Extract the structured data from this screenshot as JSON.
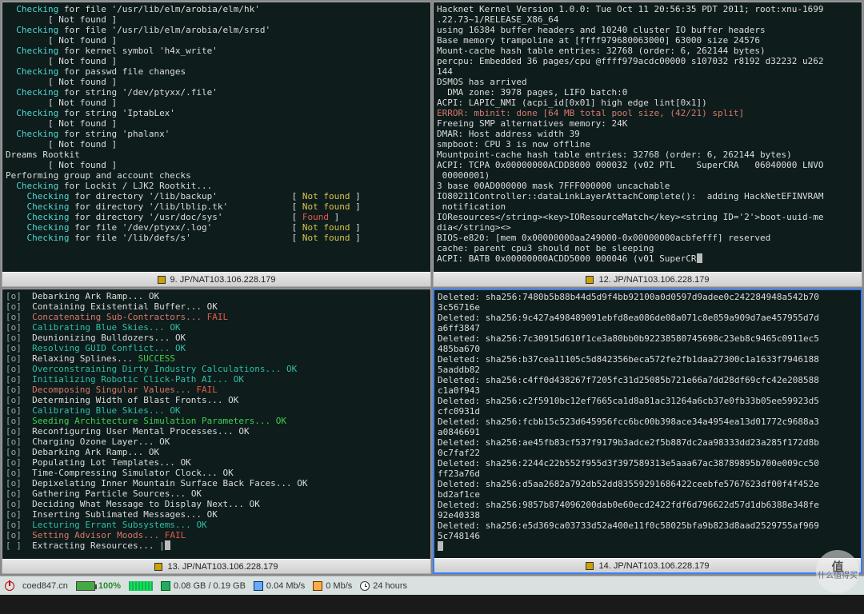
{
  "titles": {
    "p1": "9. JP/NAT103.106.228.179",
    "p2": "12. JP/NAT103.106.228.179",
    "p3": "13. JP/NAT103.106.228.179",
    "p4": "14. JP/NAT103.106.228.179"
  },
  "icon_label": "terminal-icon",
  "pane1": {
    "lines": [
      {
        "indent": 1,
        "pre": "Checking",
        "body": " for file '/usr/lib/elm/arobia/elm/hk'",
        "cls": "c-cyan"
      },
      {
        "indent": 4,
        "body": "[ Not found ]",
        "cls": "c-white"
      },
      {
        "indent": 1,
        "pre": "Checking",
        "body": " for file '/usr/lib/elm/arobia/elm/srsd'",
        "cls": "c-cyan"
      },
      {
        "indent": 4,
        "body": "[ Not found ]",
        "cls": "c-white"
      },
      {
        "indent": 1,
        "pre": "Checking",
        "body": " for kernel symbol 'h4x_write'",
        "cls": "c-cyan"
      },
      {
        "indent": 4,
        "body": "[ Not found ]",
        "cls": "c-white"
      },
      {
        "indent": 1,
        "pre": "Checking",
        "body": " for passwd file changes",
        "cls": "c-cyan"
      },
      {
        "indent": 4,
        "body": "[ Not found ]",
        "cls": "c-white"
      },
      {
        "indent": 1,
        "pre": "Checking",
        "body": " for string '/dev/ptyxx/.file'",
        "cls": "c-cyan"
      },
      {
        "indent": 4,
        "body": "[ Not found ]",
        "cls": "c-white"
      },
      {
        "indent": 1,
        "pre": "Checking",
        "body": " for string 'IptabLex'",
        "cls": "c-cyan"
      },
      {
        "indent": 4,
        "body": "[ Not found ]",
        "cls": "c-white"
      },
      {
        "indent": 1,
        "pre": "Checking",
        "body": " for string 'phalanx'",
        "cls": "c-cyan"
      },
      {
        "indent": 4,
        "body": "[ Not found ]",
        "cls": "c-white"
      },
      {
        "indent": 0,
        "body": "Dreams Rootkit",
        "cls": "c-white"
      },
      {
        "indent": 4,
        "body": "[ Not found ]",
        "cls": "c-white"
      },
      {
        "indent": 0,
        "body": "",
        "cls": ""
      },
      {
        "indent": 0,
        "body": "Performing group and account checks",
        "cls": "c-white"
      },
      {
        "indent": 1,
        "pre": "Checking",
        "body": " for Lockit / LJK2 Rootkit...",
        "cls": "c-cyan"
      }
    ],
    "dir_rows": [
      {
        "text": "Checking for directory '/lib/backup'",
        "status": "Not found",
        "scls": "c-yellow"
      },
      {
        "text": "Checking for directory '/lib/lblip.tk'",
        "status": "Not found",
        "scls": "c-yellow"
      },
      {
        "text": "Checking for directory '/usr/doc/sys'",
        "status": "Found",
        "scls": "c-red"
      },
      {
        "text": "Checking for file '/dev/ptyxx/.log'",
        "status": "Not found",
        "scls": "c-yellow"
      },
      {
        "text": "Checking for file '/lib/defs/s'",
        "status": "Not found",
        "scls": "c-yellow"
      }
    ]
  },
  "pane2": {
    "lines": [
      "Hacknet Kernel Version 1.0.0: Tue Oct 11 20:56:35 PDT 2011; root:xnu-1699",
      ".22.73~1/RELEASE_X86_64",
      "using 16384 buffer headers and 10240 cluster IO buffer headers",
      "Base memory trampoline at [ffff979680063000] 63000 size 24576",
      "Mount-cache hash table entries: 32768 (order: 6, 262144 bytes)",
      "percpu: Embedded 36 pages/cpu @ffff979acdc00000 s107032 r8192 d32232 u262",
      "144",
      "DSMOS has arrived",
      "  DMA zone: 3978 pages, LIFO batch:0",
      "ACPI: LAPIC_NMI (acpi_id[0x01] high edge lint[0x1])",
      {
        "text": "ERROR: mbinit: done [64 MB total pool size, (42/21) split]",
        "cls": "c-lred"
      },
      "Freeing SMP alternatives memory: 24K",
      "DMAR: Host address width 39",
      "smpboot: CPU 3 is now offline",
      "Mountpoint-cache hash table entries: 32768 (order: 6, 262144 bytes)",
      "ACPI: TCPA 0x00000000ACDD8000 000032 (v02 PTL    SuperCRA   06040000 LNVO",
      " 00000001)",
      "3 base 00AD000000 mask 7FFF000000 uncachable",
      "IO80211Controller::dataLinkLayerAttachComplete():  adding HackNetEFINVRAM",
      " notification",
      "IOResources</string><key>IOResourceMatch</key><string ID='2'>boot-uuid-me",
      "dia</string><>",
      "BIOS-e820: [mem 0x00000000aa249000-0x00000000acbfefff] reserved",
      "cache: parent cpu3 should not be sleeping",
      {
        "text": "ACPI: BATB 0x00000000ACDD5000 000046 (v01 SuperCR",
        "cursor": true
      }
    ]
  },
  "pane3": {
    "rows": [
      {
        "t": "Debarking Ark Ramp... ",
        "s": "OK",
        "c": "c-white"
      },
      {
        "t": "Containing Existential Buffer... ",
        "s": "OK",
        "c": "c-white"
      },
      {
        "t": "Concatenating Sub-Contractors... ",
        "s": "FAIL",
        "c": "c-red",
        "tc": "c-lred"
      },
      {
        "t": "Calibrating Blue Skies... ",
        "s": "OK",
        "c": "c-teal",
        "tc": "c-teal"
      },
      {
        "t": "Deunionizing Bulldozers... ",
        "s": "OK",
        "c": "c-white"
      },
      {
        "t": "Resolving GUID Conflict... ",
        "s": "OK",
        "c": "c-teal",
        "tc": "c-teal"
      },
      {
        "t": "Relaxing Splines... ",
        "s": "SUCCESS",
        "c": "c-green",
        "tc": "c-white"
      },
      {
        "t": "Overconstraining Dirty Industry Calculations... ",
        "s": "OK",
        "c": "c-teal",
        "tc": "c-teal"
      },
      {
        "t": "Initializing Robotic Click-Path AI... ",
        "s": "OK",
        "c": "c-teal",
        "tc": "c-teal"
      },
      {
        "t": "Decomposing Singular Values... ",
        "s": "FAIL",
        "c": "c-red",
        "tc": "c-lred"
      },
      {
        "t": "Determining Width of Blast Fronts... ",
        "s": "OK",
        "c": "c-white"
      },
      {
        "t": "Calibrating Blue Skies... ",
        "s": "OK",
        "c": "c-teal",
        "tc": "c-teal"
      },
      {
        "t": "Seeding Architecture Simulation Parameters... ",
        "s": "OK",
        "c": "c-green",
        "tc": "c-green"
      },
      {
        "t": "Reconfiguring User Mental Processes... ",
        "s": "OK",
        "c": "c-white"
      },
      {
        "t": "Charging Ozone Layer... ",
        "s": "OK",
        "c": "c-white"
      },
      {
        "t": "Debarking Ark Ramp... ",
        "s": "OK",
        "c": "c-white"
      },
      {
        "t": "Populating Lot Templates... ",
        "s": "OK",
        "c": "c-white"
      },
      {
        "t": "Time-Compressing Simulator Clock... ",
        "s": "OK",
        "c": "c-white"
      },
      {
        "t": "Depixelating Inner Mountain Surface Back Faces... ",
        "s": "OK",
        "c": "c-white"
      },
      {
        "t": "Gathering Particle Sources... ",
        "s": "OK",
        "c": "c-white"
      },
      {
        "t": "Deciding What Message to Display Next... ",
        "s": "OK",
        "c": "c-white"
      },
      {
        "t": "Inserting Sublimated Messages... ",
        "s": "OK",
        "c": "c-white"
      },
      {
        "t": "Lecturing Errant Subsystems... ",
        "s": "OK",
        "c": "c-teal",
        "tc": "c-teal"
      },
      {
        "t": "Setting Advisor Moods... ",
        "s": "FAIL",
        "c": "c-red",
        "tc": "c-lred"
      }
    ],
    "last": "Extracting Resources... |"
  },
  "pane4": {
    "entries": [
      "sha256:7480b5b88b44d5d9f4bb92100a0d0597d9adee0c242284948a542b703c56716e",
      "sha256:9c427a498489091ebfd8ea086de08a071c8e859a909d7ae457955d7da6ff3847",
      "sha256:7c30915d610f1ce3a80bb0b92238580745698c23eb8c9465c0911ec5485ba670",
      "sha256:b37cea11105c5d842356beca572fe2fb1daa27300c1a1633f79461885aaddb82",
      "sha256:c4ff0d438267f7205fc31d25085b721e66a7dd28df69cfc42e208588c1a0f943",
      "sha256:c2f5910bc12ef7665ca1d8a81ac31264a6cb37e0fb33b05ee59923d5cfc0931d",
      "sha256:fcbb15c523d645956fcc6bc00b398ace34a4954ea13d01772c9688a3a0846691",
      "sha256:ae45fb83cf537f9179b3adce2f5b887dc2aa98333dd23a285f172d8b0c7faf22",
      "sha256:2244c22b552f955d3f397589313e5aaa67ac38789895b700e009cc50ff23a76d",
      "sha256:d5aa2682a792db52dd83559291686422ceebfe5767623df00f4f452ebd2af1ce",
      "sha256:9857b874096200dab0e60ecd2422fdf6d796622d57d1db6388e348fe92e40338",
      "sha256:e5d369ca03733d52a400e11f0c58025bfa9b823d8aad2529755af9695c748146"
    ],
    "prefix": "Deleted: "
  },
  "taskbar": {
    "host": "coed847.cn",
    "battery": "100%",
    "ram": "0.08 GB / 0.19 GB",
    "net_down": "0.04 Mb/s",
    "net_up": "0 Mb/s",
    "uptime": "24 hours"
  },
  "watermark": {
    "top": "值",
    "bot": "什么值得买"
  }
}
